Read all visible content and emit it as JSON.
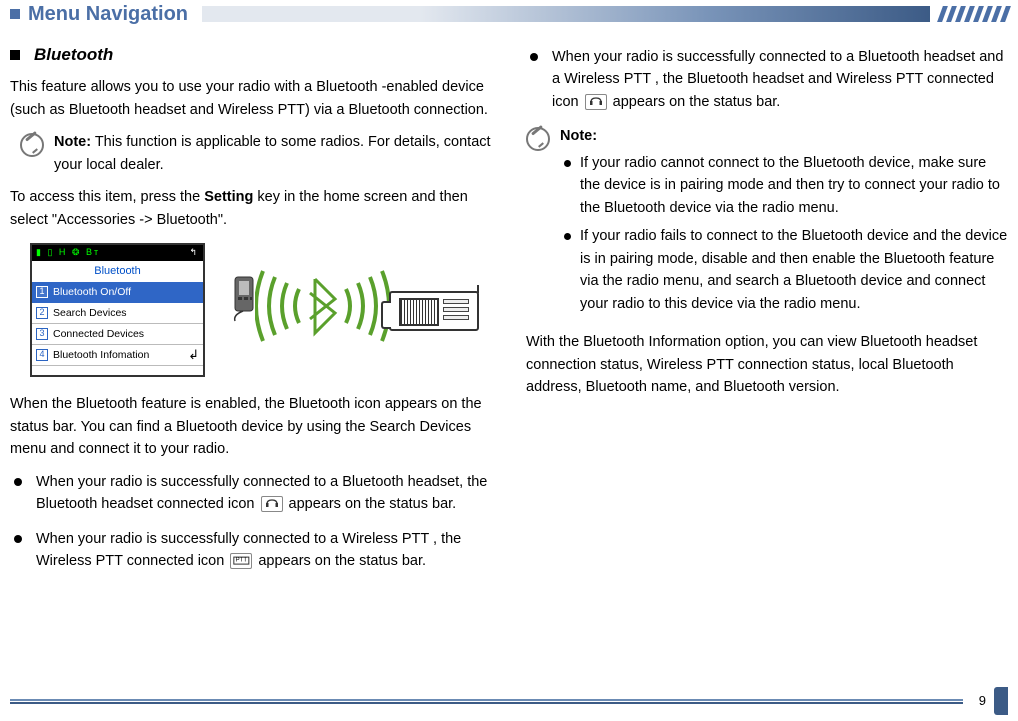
{
  "header": {
    "title": "Menu Navigation"
  },
  "left": {
    "subhead": "Bluetooth",
    "intro": "This feature allows you to use your radio with a Bluetooth -enabled device (such as Bluetooth headset and Wireless PTT) via a Bluetooth connection.",
    "note_label": "Note:",
    "note_text": " This function is applicable to some radios. For details, contact your local dealer.",
    "access_pre": "To access this item, press the ",
    "access_key": "Setting",
    "access_post": " key in the home screen and then select \"Accessories -> Bluetooth\".",
    "screen": {
      "title": "Bluetooth",
      "status_left": "▮ ▯ H ❂ Bᴛ",
      "status_right": "↰",
      "rows": [
        {
          "n": "1",
          "label": "Bluetooth On/Off",
          "sel": true
        },
        {
          "n": "2",
          "label": "Search Devices",
          "sel": false
        },
        {
          "n": "3",
          "label": "Connected Devices",
          "sel": false
        },
        {
          "n": "4",
          "label": "Bluetooth Infomation",
          "sel": false,
          "ret": "↲"
        }
      ]
    },
    "para2": "When the Bluetooth feature is enabled, the Bluetooth icon appears on the status bar. You can find a Bluetooth device by using the Search Devices menu and connect it to your radio.",
    "bullets": [
      {
        "pre": "When your radio is successfully connected to a Bluetooth headset, the Bluetooth headset connected icon ",
        "icon": "headset",
        "post": " appears on the status bar."
      },
      {
        "pre": "When your radio is successfully connected to a Wireless PTT , the Wireless PTT connected icon ",
        "icon": "ptt",
        "post": " appears on the status bar."
      }
    ]
  },
  "right": {
    "bullets": [
      {
        "pre": "When your radio is successfully connected to a Bluetooth headset and a Wireless PTT , the Bluetooth headset and Wireless PTT connected icon ",
        "icon": "headset",
        "post": " appears on the status bar."
      }
    ],
    "note_label": "Note:",
    "note_items": [
      "If your radio cannot connect to the Bluetooth device, make sure the device is in pairing mode and then try to connect your radio to the Bluetooth device via the radio menu.",
      "If your radio fails to connect to the Bluetooth device and the device is in pairing mode, disable and then enable the Bluetooth feature via the radio menu, and search a Bluetooth device and connect your radio to this device via the radio menu."
    ],
    "para": "With the Bluetooth Information option, you can view Bluetooth headset connection status, Wireless PTT connection status, local Bluetooth address, Bluetooth name, and Bluetooth version."
  },
  "page_number": "9"
}
